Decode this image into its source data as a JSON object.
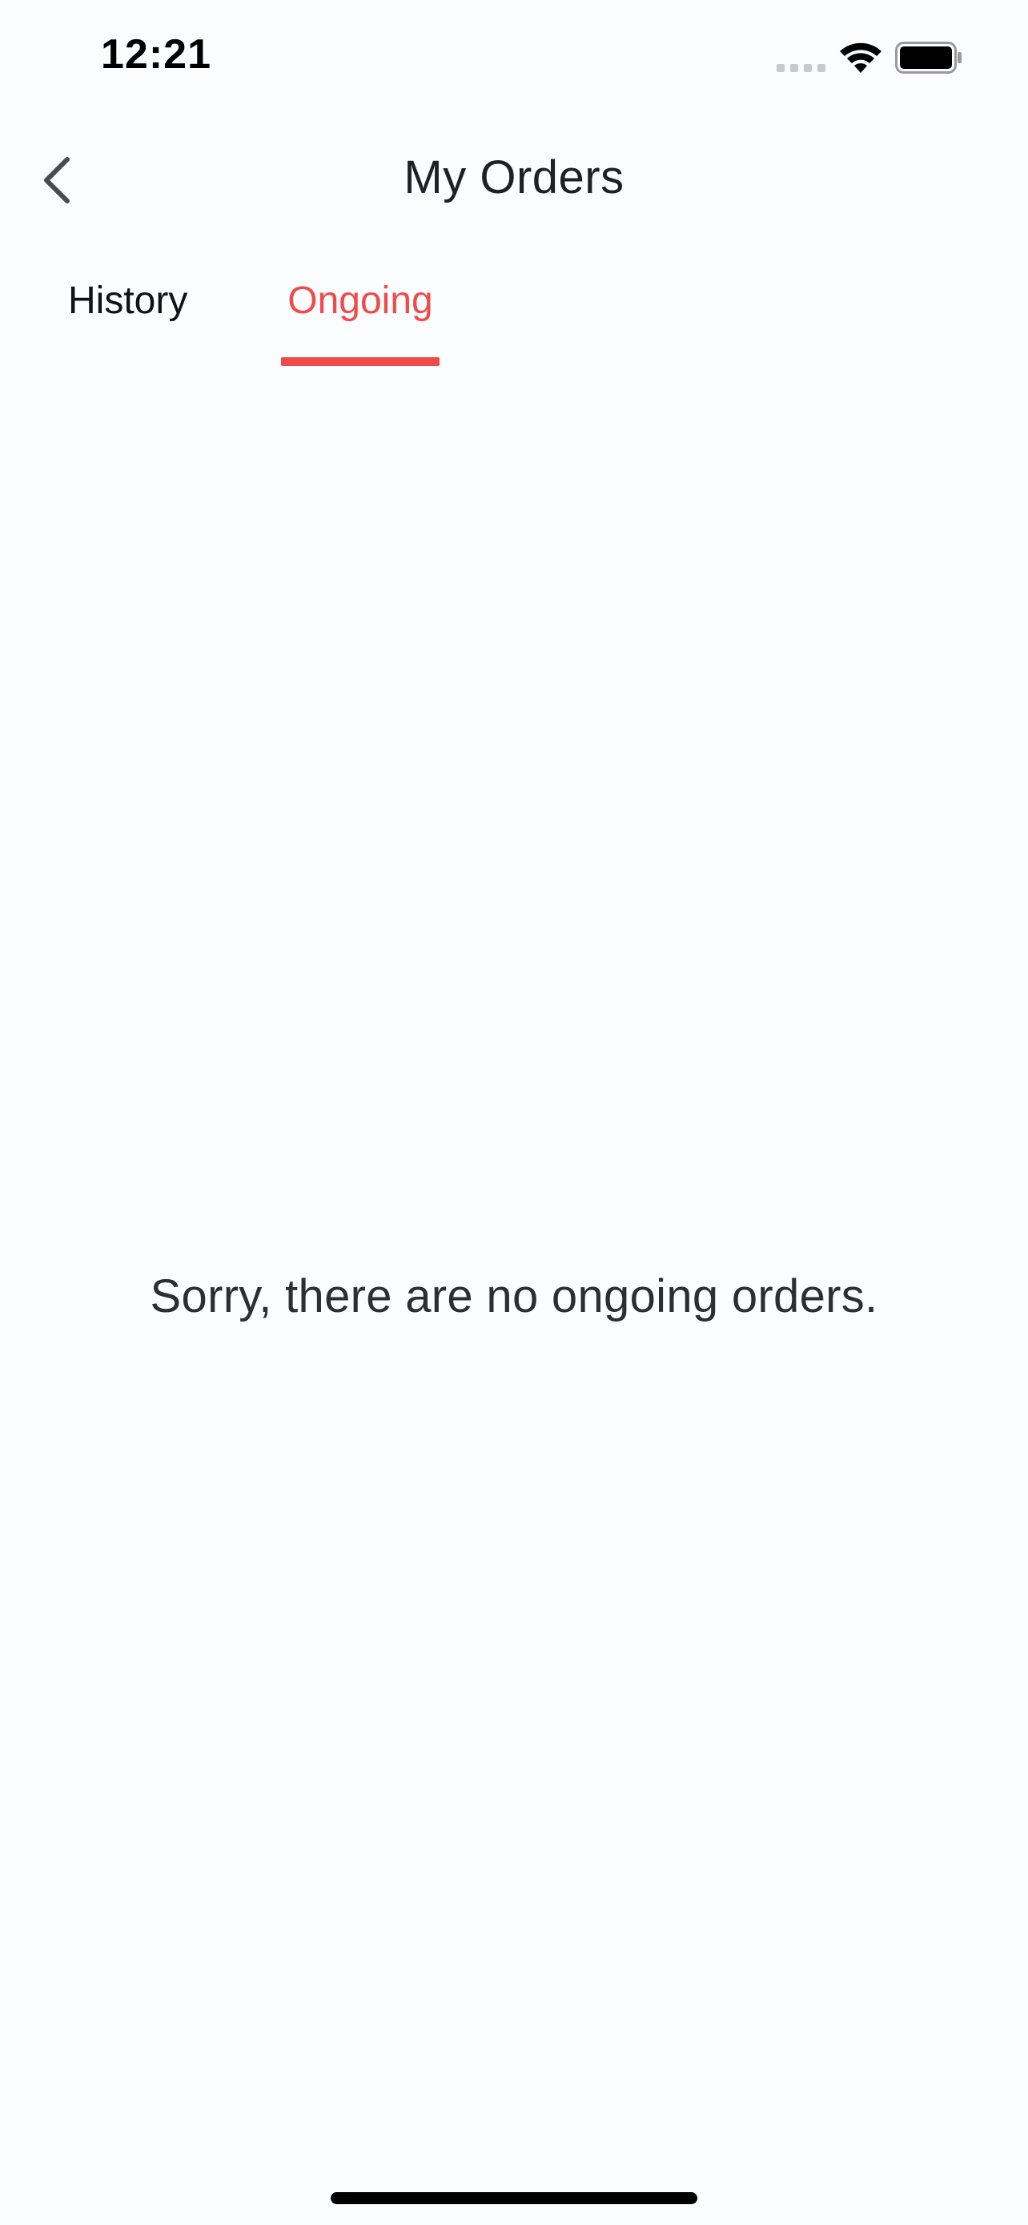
{
  "status_bar": {
    "time": "12:21",
    "icons": [
      "signal-icon",
      "wifi-icon",
      "battery-icon"
    ]
  },
  "header": {
    "title": "My Orders",
    "back_icon": "chevron-left-icon"
  },
  "tabs": [
    {
      "label": "History",
      "active": false
    },
    {
      "label": "Ongoing",
      "active": true
    }
  ],
  "empty_state": {
    "message": "Sorry, there are no ongoing orders."
  },
  "colors": {
    "accent": "#ef4b4b",
    "background": "#fbfcfe",
    "text": "#1f1f24"
  }
}
